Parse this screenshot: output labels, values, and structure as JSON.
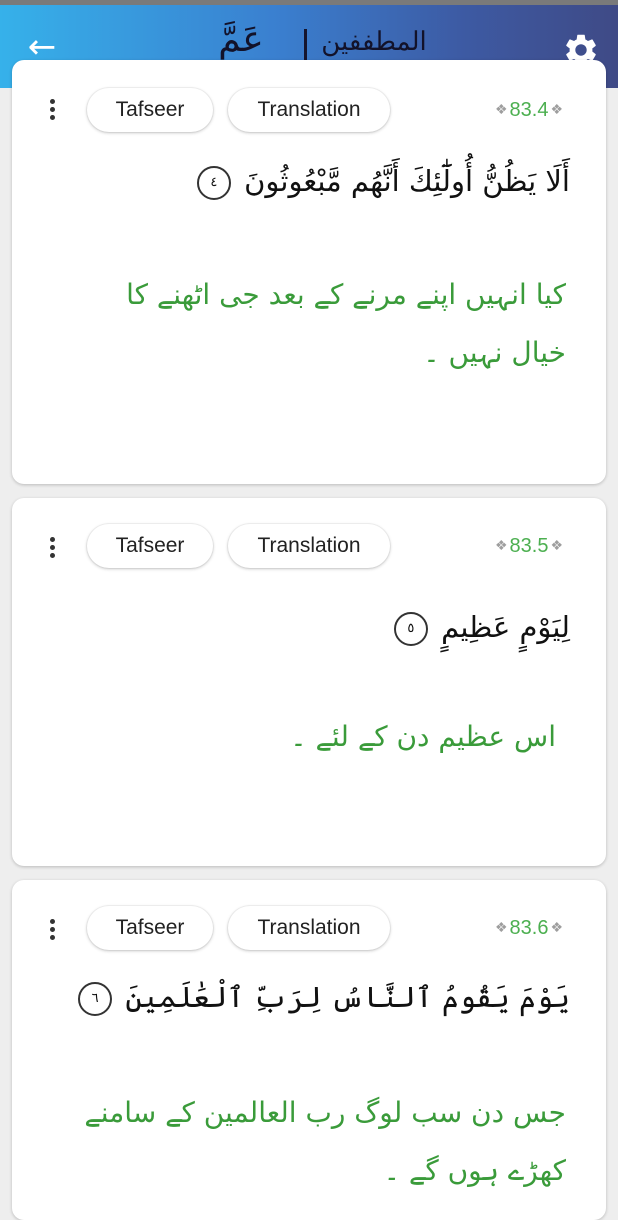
{
  "header": {
    "juz_name": "عَمَّ",
    "surah_name": "المطففين",
    "back_icon": "arrow-left-icon",
    "settings_icon": "gear-icon",
    "colors": {
      "gradient_start": "#36b1ea",
      "gradient_end": "#3f4a86"
    }
  },
  "verses": [
    {
      "number": "83.4",
      "tafseer_label": "Tafseer",
      "translation_label": "Translation",
      "arabic": "أَلَا يَظُنُّ أُولَٰٓئِكَ أَنَّهُم مَّبْعُوثُونَ",
      "ayah_marker": "٤",
      "urdu": "کیا انہیں اپنے مرنے کے بعد جی اٹھنے کا خیال نہیں ۔"
    },
    {
      "number": "83.5",
      "tafseer_label": "Tafseer",
      "translation_label": "Translation",
      "arabic": "لِيَوْمٍ عَظِيمٍ",
      "ayah_marker": "٥",
      "urdu": "اس عظیم دن کے لئے ۔"
    },
    {
      "number": "83.6",
      "tafseer_label": "Tafseer",
      "translation_label": "Translation",
      "arabic": "يَوْمَ يَقُومُ ٱلنَّاسُ لِرَبِّ ٱلْعَٰلَمِينَ",
      "ayah_marker": "٦",
      "urdu": "جس دن سب لوگ رب العالمین کے سامنے کھڑے ہوں گے ۔"
    }
  ],
  "colors": {
    "verse_number": "#4caf50",
    "translation_text": "#3a9b3a"
  }
}
